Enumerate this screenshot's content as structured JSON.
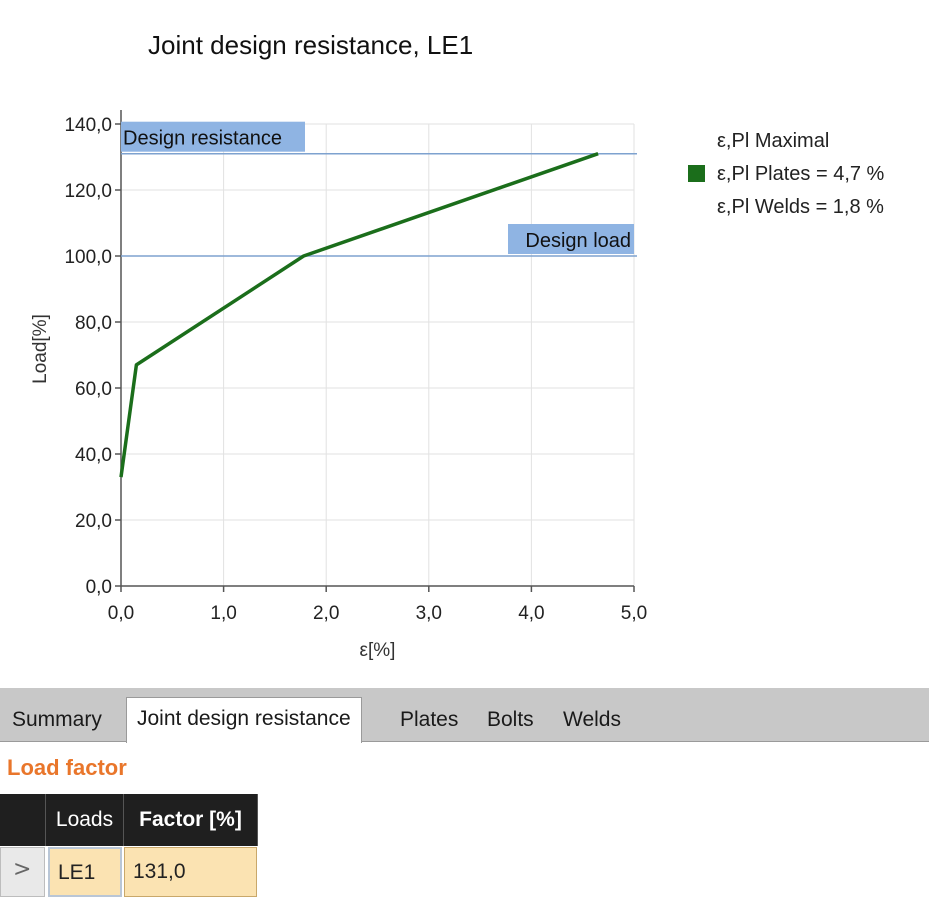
{
  "chart_data": {
    "type": "line",
    "title": "Joint design resistance, LE1",
    "xlabel": "ε[%]",
    "ylabel": "Load[%]",
    "xlim": [
      0,
      5
    ],
    "ylim": [
      0,
      140
    ],
    "x_ticks": [
      "0,0",
      "1,0",
      "2,0",
      "3,0",
      "4,0",
      "5,0"
    ],
    "y_ticks": [
      "0,0",
      "20,0",
      "40,0",
      "60,0",
      "80,0",
      "100,0",
      "120,0",
      "140,0"
    ],
    "grid": true,
    "legend_position": "right",
    "series": [
      {
        "name": "ε,Pl Plates = 4,7 %",
        "color": "#1b6e1b",
        "x": [
          0.0,
          0.15,
          1.78,
          4.65
        ],
        "y": [
          33,
          67,
          100,
          131
        ]
      }
    ],
    "reference_lines": [
      {
        "label": "Design resistance",
        "y": 131,
        "color": "#8fb4e3"
      },
      {
        "label": "Design load",
        "y": 100,
        "color": "#8fb4e3"
      }
    ],
    "legend_entries": [
      {
        "text": "ε,Pl Maximal",
        "swatch": false
      },
      {
        "text": "ε,Pl Plates = 4,7 %",
        "swatch": true,
        "color": "#1b6e1b"
      },
      {
        "text": "ε,Pl Welds = 1,8 %",
        "swatch": false
      }
    ]
  },
  "tabs": [
    {
      "label": "Summary",
      "active": false
    },
    {
      "label": "Joint design resistance",
      "active": true
    },
    {
      "label": "Plates",
      "active": false
    },
    {
      "label": "Bolts",
      "active": false
    },
    {
      "label": "Welds",
      "active": false
    }
  ],
  "section": {
    "title": "Load factor"
  },
  "table": {
    "headers": [
      "Loads",
      "Factor [%]"
    ],
    "rows": [
      {
        "marker": ">",
        "loads": "LE1",
        "factor": "131,0"
      }
    ]
  }
}
